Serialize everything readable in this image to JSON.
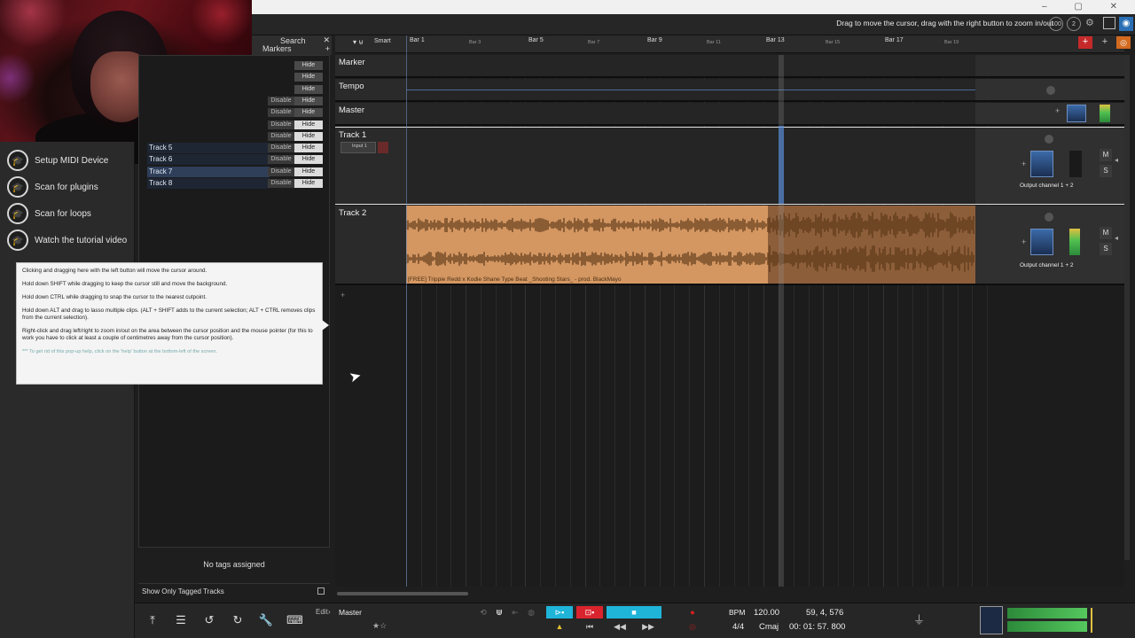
{
  "topbar": {
    "hint": "Drag to move the cursor, drag with the right button to zoom in/out",
    "zoom_badge": "100",
    "counter_badge": "2"
  },
  "left_panel": {
    "items": [
      {
        "label": "Setup MIDI Device",
        "icon": "graduation-cap-icon"
      },
      {
        "label": "Scan for plugins",
        "icon": "graduation-cap-icon"
      },
      {
        "label": "Scan for loops",
        "icon": "graduation-cap-icon"
      },
      {
        "label": "Watch the tutorial video",
        "icon": "graduation-cap-icon"
      }
    ]
  },
  "search_panel": {
    "search": "Search",
    "markers": "Markers",
    "close": "✕",
    "add": "+"
  },
  "track_list": {
    "rows": [
      {
        "name": "",
        "disable": "",
        "hide": "Hide",
        "lit": false
      },
      {
        "name": "",
        "disable": "",
        "hide": "Hide",
        "lit": false
      },
      {
        "name": "",
        "disable": "",
        "hide": "Hide",
        "lit": false
      },
      {
        "name": "",
        "disable": "Disable",
        "hide": "Hide",
        "lit": false
      },
      {
        "name": "",
        "disable": "Disable",
        "hide": "Hide",
        "lit": false
      },
      {
        "name": "",
        "disable": "Disable",
        "hide": "Hide",
        "lit": true
      },
      {
        "name": "",
        "disable": "Disable",
        "hide": "Hide",
        "lit": true
      },
      {
        "name": "Track 5",
        "disable": "Disable",
        "hide": "Hide",
        "lit": true
      },
      {
        "name": "Track 6",
        "disable": "Disable",
        "hide": "Hide",
        "lit": true
      },
      {
        "name": "Track 7",
        "disable": "Disable",
        "hide": "Hide",
        "lit": true
      },
      {
        "name": "Track 8",
        "disable": "Disable",
        "hide": "Hide",
        "lit": true
      }
    ],
    "no_tags": "No tags assigned",
    "show_tagged": "Show Only Tagged Tracks"
  },
  "help": {
    "p1": "Clicking and dragging here with the left button will move the cursor around.",
    "p2": "Hold down SHIFT while dragging to keep the cursor still and move the background.",
    "p3": "Hold down CTRL while dragging to snap the cursor to the nearest cutpoint.",
    "p4": "Hold down ALT and drag to lasso multiple clips. (ALT + SHIFT adds to the current selection; ALT + CTRL removes clips from the current selection).",
    "p5": "Right-click and drag left/right to zoom in/out on the area between the cursor position and the mouse pointer (for this to work you have to click at least a couple of centimetres away from the cursor position).",
    "p6": "*** To get rid of this pop-up help, click on the 'help' button at the bottom-left of the screen."
  },
  "ruler": {
    "mode": "Smart",
    "bars": [
      {
        "label": "Bar 1",
        "small": false
      },
      {
        "label": "Bar 3",
        "small": true
      },
      {
        "label": "Bar 5",
        "small": false
      },
      {
        "label": "Bar 7",
        "small": true
      },
      {
        "label": "Bar 9",
        "small": false
      },
      {
        "label": "Bar 11",
        "small": true
      },
      {
        "label": "Bar 13",
        "small": false
      },
      {
        "label": "Bar 15",
        "small": true
      },
      {
        "label": "Bar 17",
        "small": false
      },
      {
        "label": "Bar 19",
        "small": true
      }
    ]
  },
  "tracks": {
    "marker": "Marker",
    "tempo": "Tempo",
    "master": "Master",
    "track1": "Track 1",
    "track1_input": "Input 1",
    "track2": "Track 2",
    "output1": "Output channel 1 + 2",
    "output2": "Output channel 1 + 2",
    "clip_name": "[FREE] Trippie Redd x Kodie Shane Type Beat _Shooting Stars_ - prod. BlackMayo",
    "mute": "M",
    "solo": "S"
  },
  "bottom": {
    "edit": "Edit",
    "edit_target": "Master",
    "bpm_label": "BPM",
    "bpm": "120.00",
    "position": "59, 4, 576",
    "timesig": "4/4",
    "key": "Cmaj",
    "time": "00: 01: 57. 800"
  },
  "colors": {
    "clip": "#d49762",
    "clip_dark": "#8d5e3a",
    "accent_cyan": "#1fb5d9",
    "accent_red": "#d9242e",
    "record_red": "#e02020"
  }
}
